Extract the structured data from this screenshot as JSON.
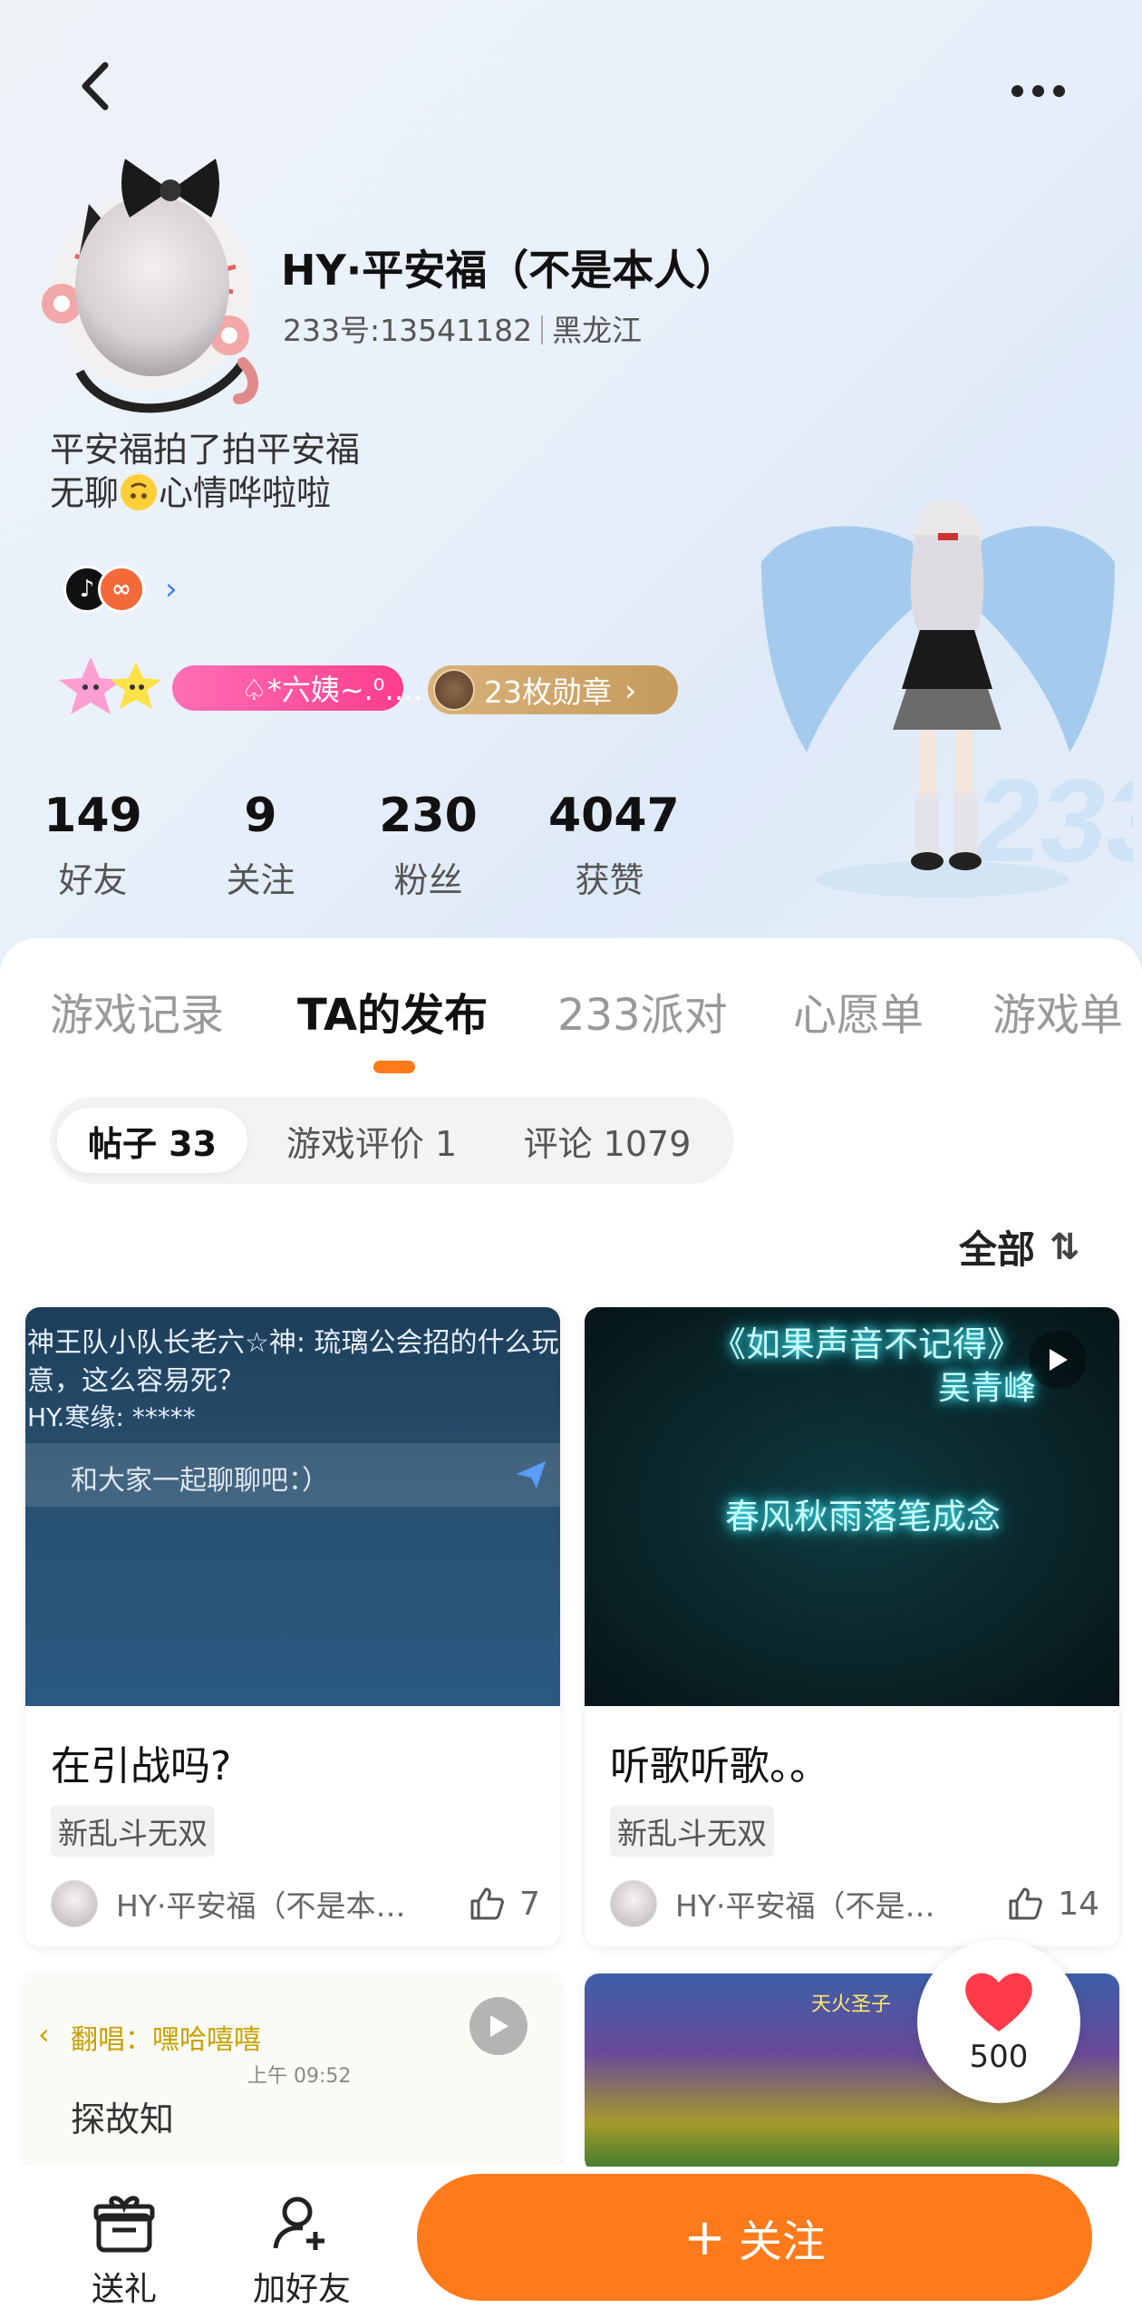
{
  "profile": {
    "name": "HY·平安福（不是本人）",
    "id_label": "233号:13541182",
    "region": "黑龙江",
    "bio_line1": "平安福拍了拍平安福",
    "bio_line2a": "无聊",
    "bio_line2b": "心情哗啦啦",
    "title_badge": "♤*六姨~.⁰.…",
    "medal_label": "23枚勋章"
  },
  "stats": [
    {
      "num": "149",
      "label": "好友"
    },
    {
      "num": "9",
      "label": "关注"
    },
    {
      "num": "230",
      "label": "粉丝"
    },
    {
      "num": "4047",
      "label": "获赞"
    }
  ],
  "tabs": [
    "游戏记录",
    "TA的发布",
    "233派对",
    "心愿单",
    "游戏单"
  ],
  "active_tab": "TA的发布",
  "subtabs": [
    "帖子 33",
    "游戏评价 1",
    "评论 1079"
  ],
  "sort_label": "全部",
  "cards": [
    {
      "title": "在引战吗?",
      "tag": "新乱斗无双",
      "author": "HY·平安福（不是本…",
      "likes": "7",
      "thumb_text1": "神王队小队长老六☆神: 琉璃公会招的什么玩",
      "thumb_text2": "意，这么容易死？",
      "thumb_text3": "HY.寒缘: *****",
      "thumb_chat": "和大家一起聊聊吧：）"
    },
    {
      "title": "听歌听歌。。",
      "tag": "新乱斗无双",
      "author": "HY·平安福（不是…",
      "likes": "14",
      "thumb_text1": "《如果声音不记得》",
      "thumb_text2": "吴青峰",
      "thumb_text3": "春风秋雨落笔成念"
    },
    {
      "thumb_header": "翻唱：嘿哈嘻嘻",
      "thumb_time": "上午 09:52",
      "thumb_body": "探故知"
    },
    {
      "thumb_text1": "天火圣子"
    }
  ],
  "like_float_count": "500",
  "bottom": {
    "gift": "送礼",
    "add_friend": "加好友",
    "follow": "关注"
  },
  "colors": {
    "accent": "#ff7a1a",
    "pink_badge": "#ff4f9a",
    "medal": "#d0a56a",
    "link_blue": "#3b82f6"
  }
}
